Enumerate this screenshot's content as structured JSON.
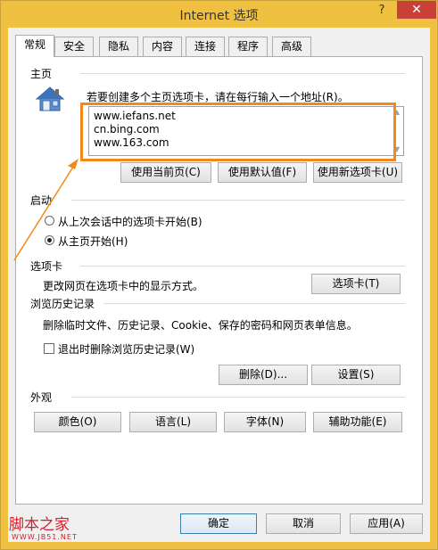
{
  "window": {
    "title": "Internet 选项",
    "help": "?",
    "close": "✕"
  },
  "tabs": [
    "常规",
    "安全",
    "隐私",
    "内容",
    "连接",
    "程序",
    "高级"
  ],
  "home": {
    "group": "主页",
    "instruction": "若要创建多个主页选项卡，请在每行输入一个地址(R)。",
    "urls": [
      "www.iefans.net",
      "cn.bing.com",
      "www.163.com"
    ],
    "buttons": [
      "使用当前页(C)",
      "使用默认值(F)",
      "使用新选项卡(U)"
    ],
    "icon": "house-icon"
  },
  "startup": {
    "group": "启动",
    "options": [
      {
        "label": "从上次会话中的选项卡开始(B)",
        "checked": false
      },
      {
        "label": "从主页开始(H)",
        "checked": true
      }
    ]
  },
  "tabsGroup": {
    "group": "选项卡",
    "description": "更改网页在选项卡中的显示方式。",
    "button": "选项卡(T)"
  },
  "history": {
    "group": "浏览历史记录",
    "description": "删除临时文件、历史记录、Cookie、保存的密码和网页表单信息。",
    "checkbox": "退出时删除浏览历史记录(W)",
    "checked": false,
    "delete": "删除(D)...",
    "settings": "设置(S)"
  },
  "appearance": {
    "group": "外观",
    "buttons": [
      "颜色(O)",
      "语言(L)",
      "字体(N)",
      "辅助功能(E)"
    ]
  },
  "footer": {
    "ok": "确定",
    "cancel": "取消",
    "apply": "应用(A)"
  },
  "watermark": {
    "name": "脚本之家",
    "url": "WWW.JB51.NET"
  },
  "colors": {
    "highlight": "#f08a1a",
    "frame": "#f0c040",
    "close": "#c74139"
  }
}
